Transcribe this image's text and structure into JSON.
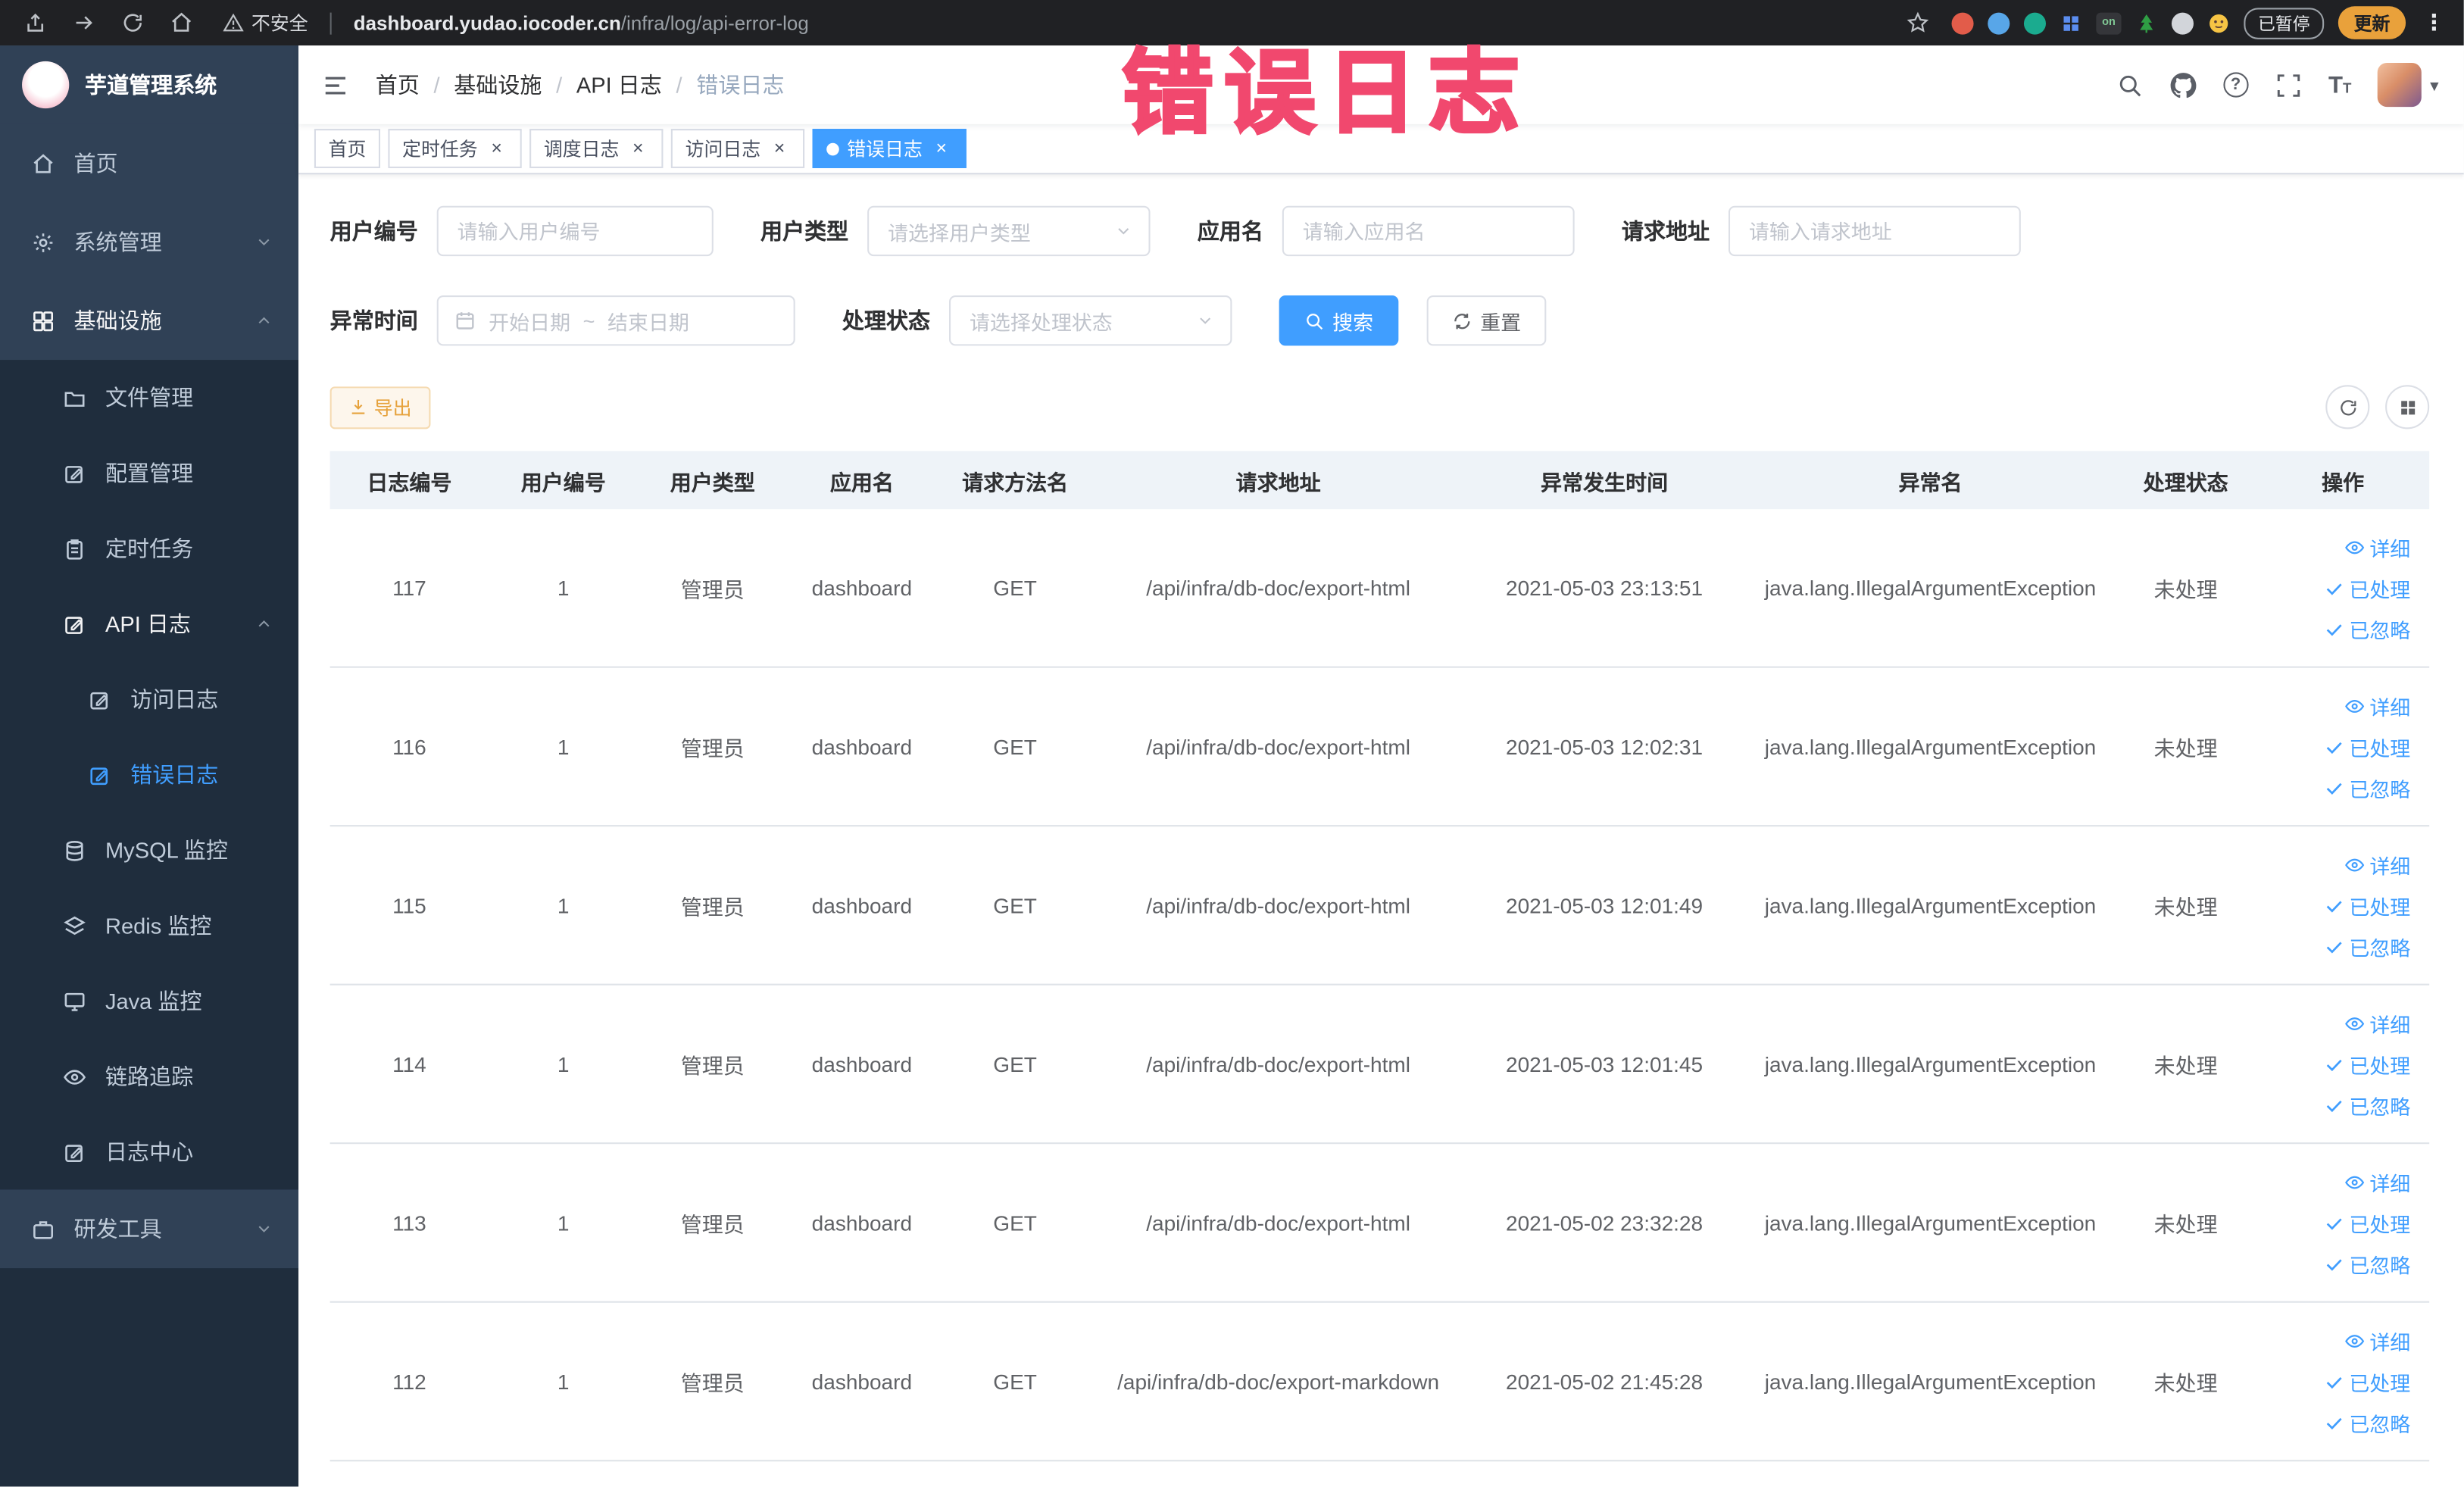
{
  "browser": {
    "security_label": "不安全",
    "url_host": "dashboard.yudao.iocoder.cn",
    "url_path": "/infra/log/api-error-log",
    "extension_on_label": "on",
    "paused_badge": "已暂停",
    "update_label": "更新"
  },
  "annotation": {
    "text": "错误日志"
  },
  "icons": {
    "close": "×",
    "more": "⋮",
    "caret": "▾",
    "question": "?",
    "font_size": "T"
  },
  "sidebar": {
    "logo_title": "芋道管理系统",
    "menu": [
      {
        "label": "首页"
      },
      {
        "label": "系统管理"
      },
      {
        "label": "基础设施"
      },
      {
        "label": "文件管理"
      },
      {
        "label": "配置管理"
      },
      {
        "label": "定时任务"
      },
      {
        "label": "API 日志"
      },
      {
        "label": "访问日志"
      },
      {
        "label": "错误日志"
      },
      {
        "label": "MySQL 监控"
      },
      {
        "label": "Redis 监控"
      },
      {
        "label": "Java 监控"
      },
      {
        "label": "链路追踪"
      },
      {
        "label": "日志中心"
      },
      {
        "label": "研发工具"
      }
    ]
  },
  "header": {
    "breadcrumb": [
      "首页",
      "基础设施",
      "API 日志",
      "错误日志"
    ]
  },
  "tabs": [
    {
      "label": "首页",
      "active": false,
      "closable": false
    },
    {
      "label": "定时任务",
      "active": false,
      "closable": true
    },
    {
      "label": "调度日志",
      "active": false,
      "closable": true
    },
    {
      "label": "访问日志",
      "active": false,
      "closable": true
    },
    {
      "label": "错误日志",
      "active": true,
      "closable": true
    }
  ],
  "filters": {
    "user_id_label": "用户编号",
    "user_id_placeholder": "请输入用户编号",
    "user_type_label": "用户类型",
    "user_type_placeholder": "请选择用户类型",
    "app_name_label": "应用名",
    "app_name_placeholder": "请输入应用名",
    "request_url_label": "请求地址",
    "request_url_placeholder": "请输入请求地址",
    "exception_time_label": "异常时间",
    "date_start_placeholder": "开始日期",
    "date_separator": "~",
    "date_end_placeholder": "结束日期",
    "process_status_label": "处理状态",
    "process_status_placeholder": "请选择处理状态",
    "search_label": "搜索",
    "reset_label": "重置"
  },
  "toolbar": {
    "export_label": "导出"
  },
  "table": {
    "columns": [
      "日志编号",
      "用户编号",
      "用户类型",
      "应用名",
      "请求方法名",
      "请求地址",
      "异常发生时间",
      "异常名",
      "处理状态",
      "操作"
    ],
    "row_actions": [
      "详细",
      "已处理",
      "已忽略"
    ],
    "rows": [
      {
        "log_id": "117",
        "user_id": "1",
        "user_type": "管理员",
        "app_name": "dashboard",
        "method": "GET",
        "url": "/api/infra/db-doc/export-html",
        "time": "2021-05-03 23:13:51",
        "exception": "java.lang.IllegalArgumentException",
        "status": "未处理"
      },
      {
        "log_id": "116",
        "user_id": "1",
        "user_type": "管理员",
        "app_name": "dashboard",
        "method": "GET",
        "url": "/api/infra/db-doc/export-html",
        "time": "2021-05-03 12:02:31",
        "exception": "java.lang.IllegalArgumentException",
        "status": "未处理"
      },
      {
        "log_id": "115",
        "user_id": "1",
        "user_type": "管理员",
        "app_name": "dashboard",
        "method": "GET",
        "url": "/api/infra/db-doc/export-html",
        "time": "2021-05-03 12:01:49",
        "exception": "java.lang.IllegalArgumentException",
        "status": "未处理"
      },
      {
        "log_id": "114",
        "user_id": "1",
        "user_type": "管理员",
        "app_name": "dashboard",
        "method": "GET",
        "url": "/api/infra/db-doc/export-html",
        "time": "2021-05-03 12:01:45",
        "exception": "java.lang.IllegalArgumentException",
        "status": "未处理"
      },
      {
        "log_id": "113",
        "user_id": "1",
        "user_type": "管理员",
        "app_name": "dashboard",
        "method": "GET",
        "url": "/api/infra/db-doc/export-html",
        "time": "2021-05-02 23:32:28",
        "exception": "java.lang.IllegalArgumentException",
        "status": "未处理"
      },
      {
        "log_id": "112",
        "user_id": "1",
        "user_type": "管理员",
        "app_name": "dashboard",
        "method": "GET",
        "url": "/api/infra/db-doc/export-markdown",
        "time": "2021-05-02 21:45:28",
        "exception": "java.lang.IllegalArgumentException",
        "status": "未处理"
      }
    ]
  }
}
